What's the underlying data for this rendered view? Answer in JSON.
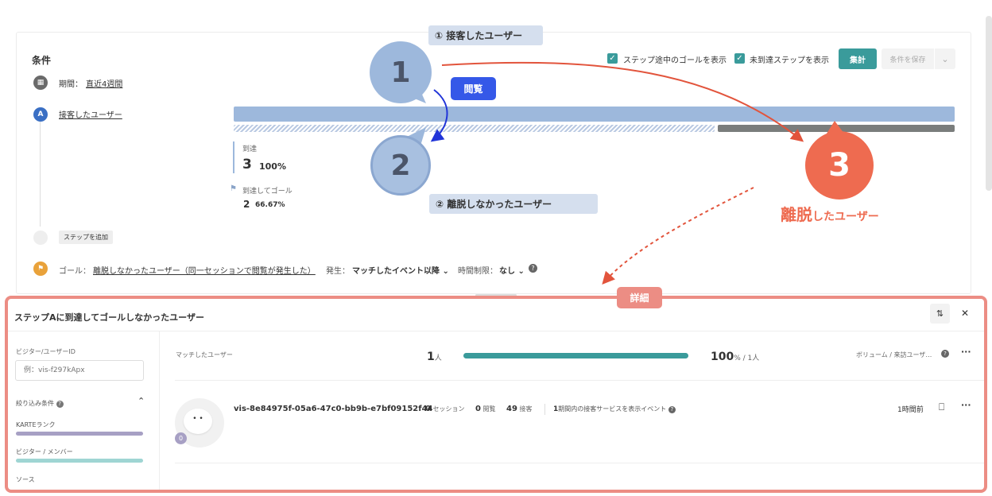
{
  "conditions": {
    "title": "条件",
    "period_label": "期間：",
    "period_value": "直近4週間",
    "step_a_marker": "A",
    "step_a_label": "接客したユーザー",
    "add_step_label": "ステップを追加",
    "goal_prefix": "ゴール：",
    "goal_value": "離脱しなかったユーザー（同一セッションで閲覧が発生した）",
    "occur_label": "発生：",
    "occur_value": "マッチしたイベント以降",
    "time_limit_label": "時間制限：",
    "time_limit_value": "なし"
  },
  "toolbar": {
    "show_midstep_goal": "ステップ途中のゴールを表示",
    "show_unreached_step": "未到達ステップを表示",
    "aggregate_button": "集計",
    "save_condition_button": "条件を保存"
  },
  "funnel": {
    "reach_label": "到達",
    "reach_count": "3",
    "reach_percent": "100%",
    "goal_label": "到達してゴール",
    "goal_count": "2",
    "goal_percent": "66.67%",
    "goal_fraction": 0.6667
  },
  "annotations": {
    "bubble1": "1",
    "bubble2": "2",
    "bubble3": "3",
    "tag1": "① 接客したユーザー",
    "tag2": "② 離脱しなかったユーザー",
    "view_badge": "閲覧",
    "churn_label_big": "離脱",
    "churn_label_small": "したユーザー",
    "detail_badge": "詳細"
  },
  "detail": {
    "title": "ステップAに到達してゴールしなかったユーザー",
    "filter_visitor_id_label": "ビジター/ユーザーID",
    "filter_visitor_id_placeholder": "例：vis-f297kApx",
    "filter_conditions_label": "絞り込み条件",
    "filter_items": [
      {
        "label": "KARTEランク",
        "color": "#a7a0c4"
      },
      {
        "label": "ビジター / メンバー",
        "color": "#9fd5d3"
      },
      {
        "label": "ソース"
      }
    ],
    "matched_label": "マッチしたユーザー",
    "matched_count": "1",
    "matched_unit": "人",
    "matched_fraction": 1.0,
    "matched_percent": "100",
    "matched_percent_suffix": "% / 1人",
    "volume_label": "ボリューム / 来訪ユーザ…",
    "user": {
      "id": "vis-8e84975f-05a6-47c0-bb9b-e7bf09152f44",
      "avatar_badge": "0",
      "sessions": "0",
      "sessions_label": "セッション",
      "views": "0",
      "views_label": "閲覧",
      "contacts": "49",
      "contacts_label": "接客",
      "event_count": "1",
      "event_label": "期間内の接客サービスを表示イベント",
      "time_ago": "1時間前"
    }
  },
  "colors": {
    "teal": "#3a9b9b",
    "funnel_bar": "#9db8dc",
    "bubble_blue": "#9db8dc",
    "bubble_orange": "#ee6b50",
    "highlight_border": "#ec8d84"
  }
}
